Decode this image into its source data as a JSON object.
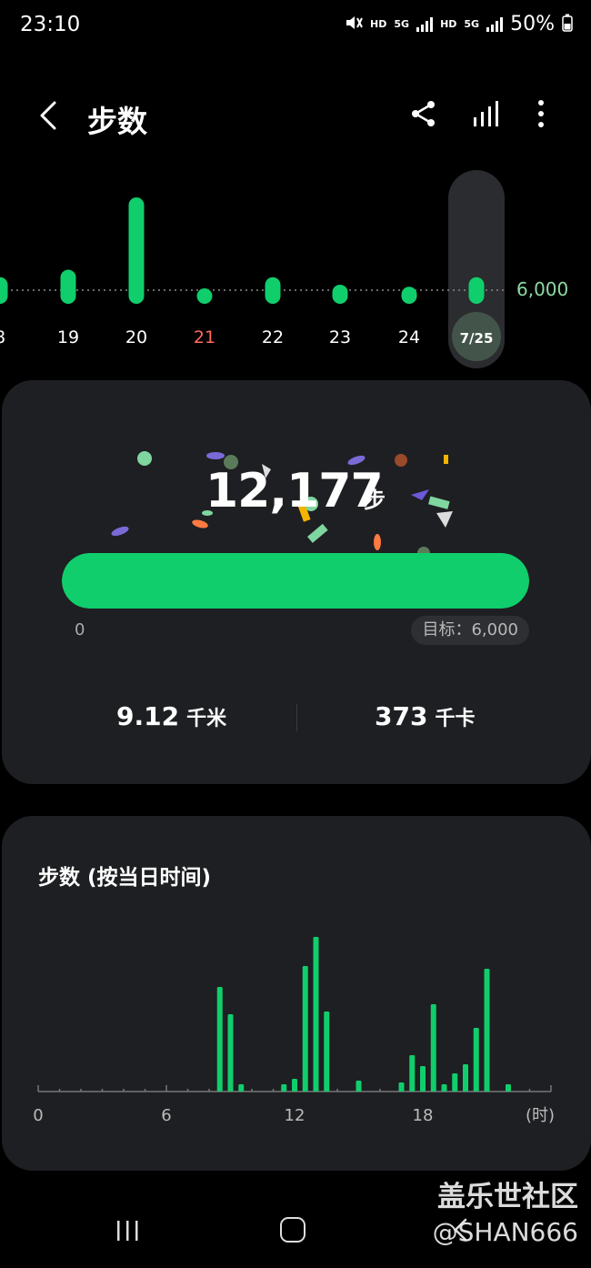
{
  "status_bar": {
    "time": "23:10",
    "hd1": "HD",
    "net1": "5G",
    "hd2": "HD",
    "net2": "5G",
    "battery": "50%"
  },
  "header": {
    "title": "步数"
  },
  "week_chart": {
    "goal_label": "6,000",
    "days": [
      {
        "label": "8",
        "steps_ratio": 0.25,
        "color": "#ffffff"
      },
      {
        "label": "19",
        "steps_ratio": 0.32,
        "color": "#ffffff"
      },
      {
        "label": "20",
        "steps_ratio": 1.0,
        "color": "#ffffff"
      },
      {
        "label": "21",
        "steps_ratio": 0.12,
        "color": "#ff6b5b"
      },
      {
        "label": "22",
        "steps_ratio": 0.25,
        "color": "#ffffff"
      },
      {
        "label": "23",
        "steps_ratio": 0.18,
        "color": "#ffffff"
      },
      {
        "label": "24",
        "steps_ratio": 0.16,
        "color": "#ffffff"
      },
      {
        "label": "7/25",
        "steps_ratio": 0.25,
        "color": "#ffffff",
        "selected": true
      }
    ]
  },
  "summary": {
    "step_count": "12,177",
    "step_unit": "步",
    "progress_min": "0",
    "goal": "目标：6,000",
    "progress_fraction": 1.0,
    "distance_value": "9.12",
    "distance_unit": "千米",
    "calories_value": "373",
    "calories_unit": "千卡"
  },
  "hourly": {
    "title": "步数 (按当日时间)",
    "x_ticks": [
      "0",
      "6",
      "12",
      "18",
      "(时)"
    ]
  },
  "chart_data": {
    "type": "bar",
    "title": "步数 (按当日时间)",
    "xlabel": "(时)",
    "x": [
      8.5,
      9.0,
      9.5,
      11.5,
      12.0,
      12.5,
      13.0,
      13.5,
      15.0,
      17.0,
      17.5,
      18.0,
      18.5,
      19.0,
      19.5,
      20.0,
      20.5,
      21.0,
      22.0
    ],
    "values": [
      115,
      85,
      8,
      8,
      14,
      138,
      170,
      88,
      12,
      10,
      40,
      28,
      96,
      8,
      20,
      30,
      70,
      135,
      8
    ],
    "xlim": [
      0,
      24
    ],
    "x_ticks": [
      0,
      6,
      12,
      18
    ]
  },
  "colors": {
    "accent": "#10ce6c",
    "card": "#1e1f22",
    "background": "#000000"
  },
  "watermark": {
    "site": "盖乐世社区",
    "user": "@SHAN666"
  }
}
